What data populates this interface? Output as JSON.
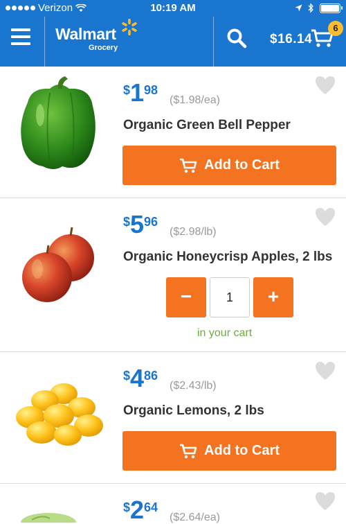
{
  "status_bar": {
    "carrier": "Verizon",
    "time": "10:19 AM"
  },
  "header": {
    "logo_word": "Walmart",
    "logo_sub": "Grocery",
    "cart_total": "$16.14",
    "cart_count": "6",
    "icons": [
      "menu-icon",
      "search-icon",
      "cart-icon"
    ]
  },
  "colors": {
    "brand_blue": "#1a75cf",
    "action_orange": "#f47321",
    "badge_yellow": "#fdbb2f",
    "in_cart_green": "#6cad3c"
  },
  "products": [
    {
      "price_currency": "$",
      "price_whole": "1",
      "price_cents": "98",
      "unit_price": "($1.98/ea)",
      "name": "Organic Green Bell Pepper",
      "action_label": "Add to Cart"
    },
    {
      "price_currency": "$",
      "price_whole": "5",
      "price_cents": "96",
      "unit_price": "($2.98/lb)",
      "name": "Organic Honeycrisp Apples, 2 lbs",
      "quantity": "1",
      "decrement_label": "−",
      "increment_label": "+",
      "status": "in your cart"
    },
    {
      "price_currency": "$",
      "price_whole": "4",
      "price_cents": "86",
      "unit_price": "($2.43/lb)",
      "name": "Organic Lemons, 2 lbs",
      "action_label": "Add to Cart"
    },
    {
      "price_currency": "$",
      "price_whole": "2",
      "price_cents": "64",
      "unit_price": "($2.64/ea)"
    }
  ]
}
